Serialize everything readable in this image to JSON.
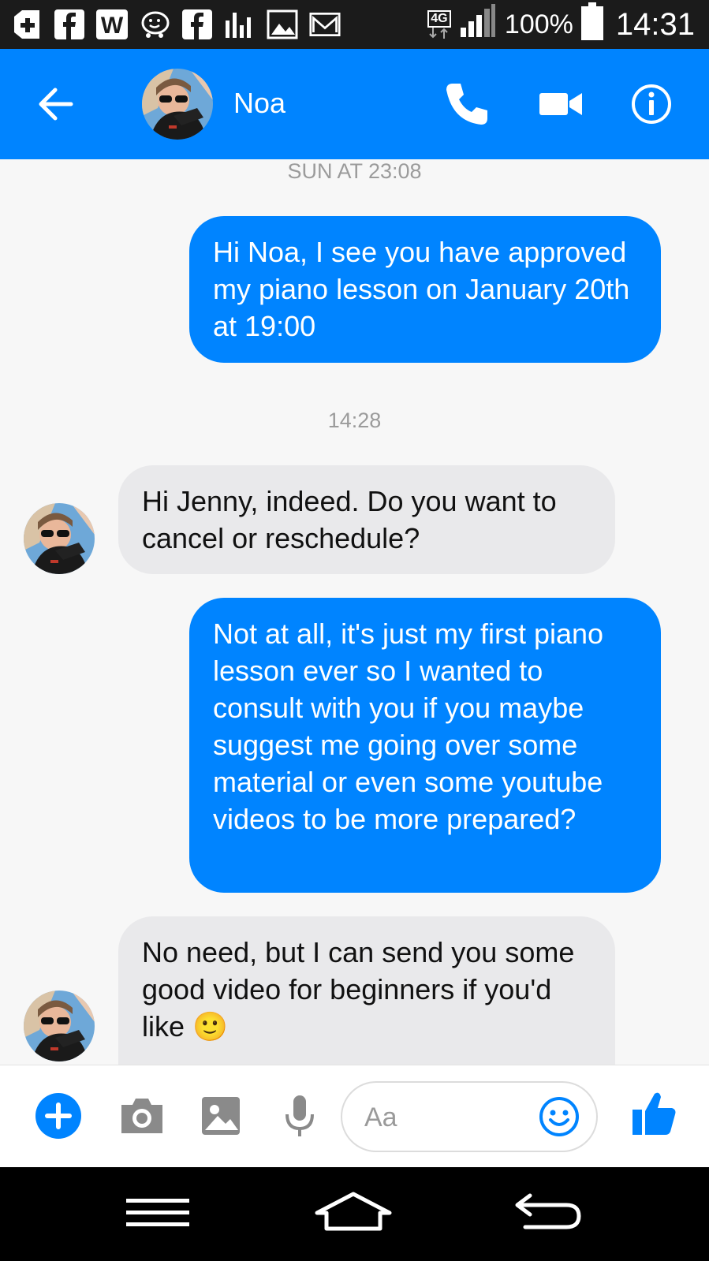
{
  "status_bar": {
    "network": "4G",
    "battery": "100%",
    "time": "14:31",
    "icons": [
      "medical-cross-icon",
      "facebook-icon",
      "w-icon",
      "waze-icon",
      "facebook-icon",
      "bars-icon",
      "image-icon",
      "gmail-icon"
    ]
  },
  "header": {
    "contact_name": "Noa"
  },
  "conversation": {
    "stamp_1": "SUN AT 23:08",
    "msg_1": "Hi Noa, I see you have approved my piano lesson on January 20th at 19:00",
    "stamp_2": "14:28",
    "msg_2": "Hi Jenny, indeed. Do you want to cancel or reschedule?",
    "msg_3": "Not at all, it's just my first piano lesson ever so I wanted to consult with you if you maybe suggest me going over some material or even some youtube videos to be more prepared?",
    "msg_4": "No need, but I can send you some good video for beginners if you'd like 🙂"
  },
  "composer": {
    "placeholder": "Aa"
  },
  "colors": {
    "accent": "#0084ff",
    "incoming_bubble": "#e9e9eb",
    "status_bar": "#1b1b1b"
  }
}
